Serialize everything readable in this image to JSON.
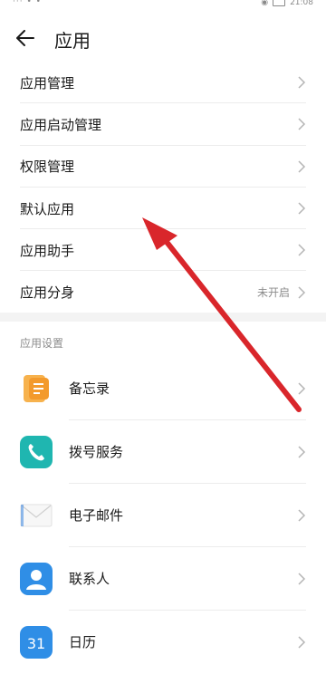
{
  "status_bar": {
    "left": "··· • •",
    "time": "21:08"
  },
  "header": {
    "title": "应用"
  },
  "menu": [
    {
      "label": "应用管理"
    },
    {
      "label": "应用启动管理"
    },
    {
      "label": "权限管理"
    },
    {
      "label": "默认应用"
    },
    {
      "label": "应用助手"
    },
    {
      "label": "应用分身",
      "value": "未开启"
    }
  ],
  "section": {
    "title": "应用设置"
  },
  "apps": [
    {
      "label": "备忘录",
      "icon": "memo-icon"
    },
    {
      "label": "拨号服务",
      "icon": "phone-icon"
    },
    {
      "label": "电子邮件",
      "icon": "email-icon"
    },
    {
      "label": "联系人",
      "icon": "contacts-icon"
    },
    {
      "label": "日历",
      "icon": "calendar-icon",
      "icon_text": "31"
    }
  ],
  "colors": {
    "accent_arrow": "#d9262b",
    "memo": "#f39a2c",
    "phone": "#1fb6b0",
    "contacts": "#2f8ee6",
    "calendar": "#2f8ee6"
  }
}
